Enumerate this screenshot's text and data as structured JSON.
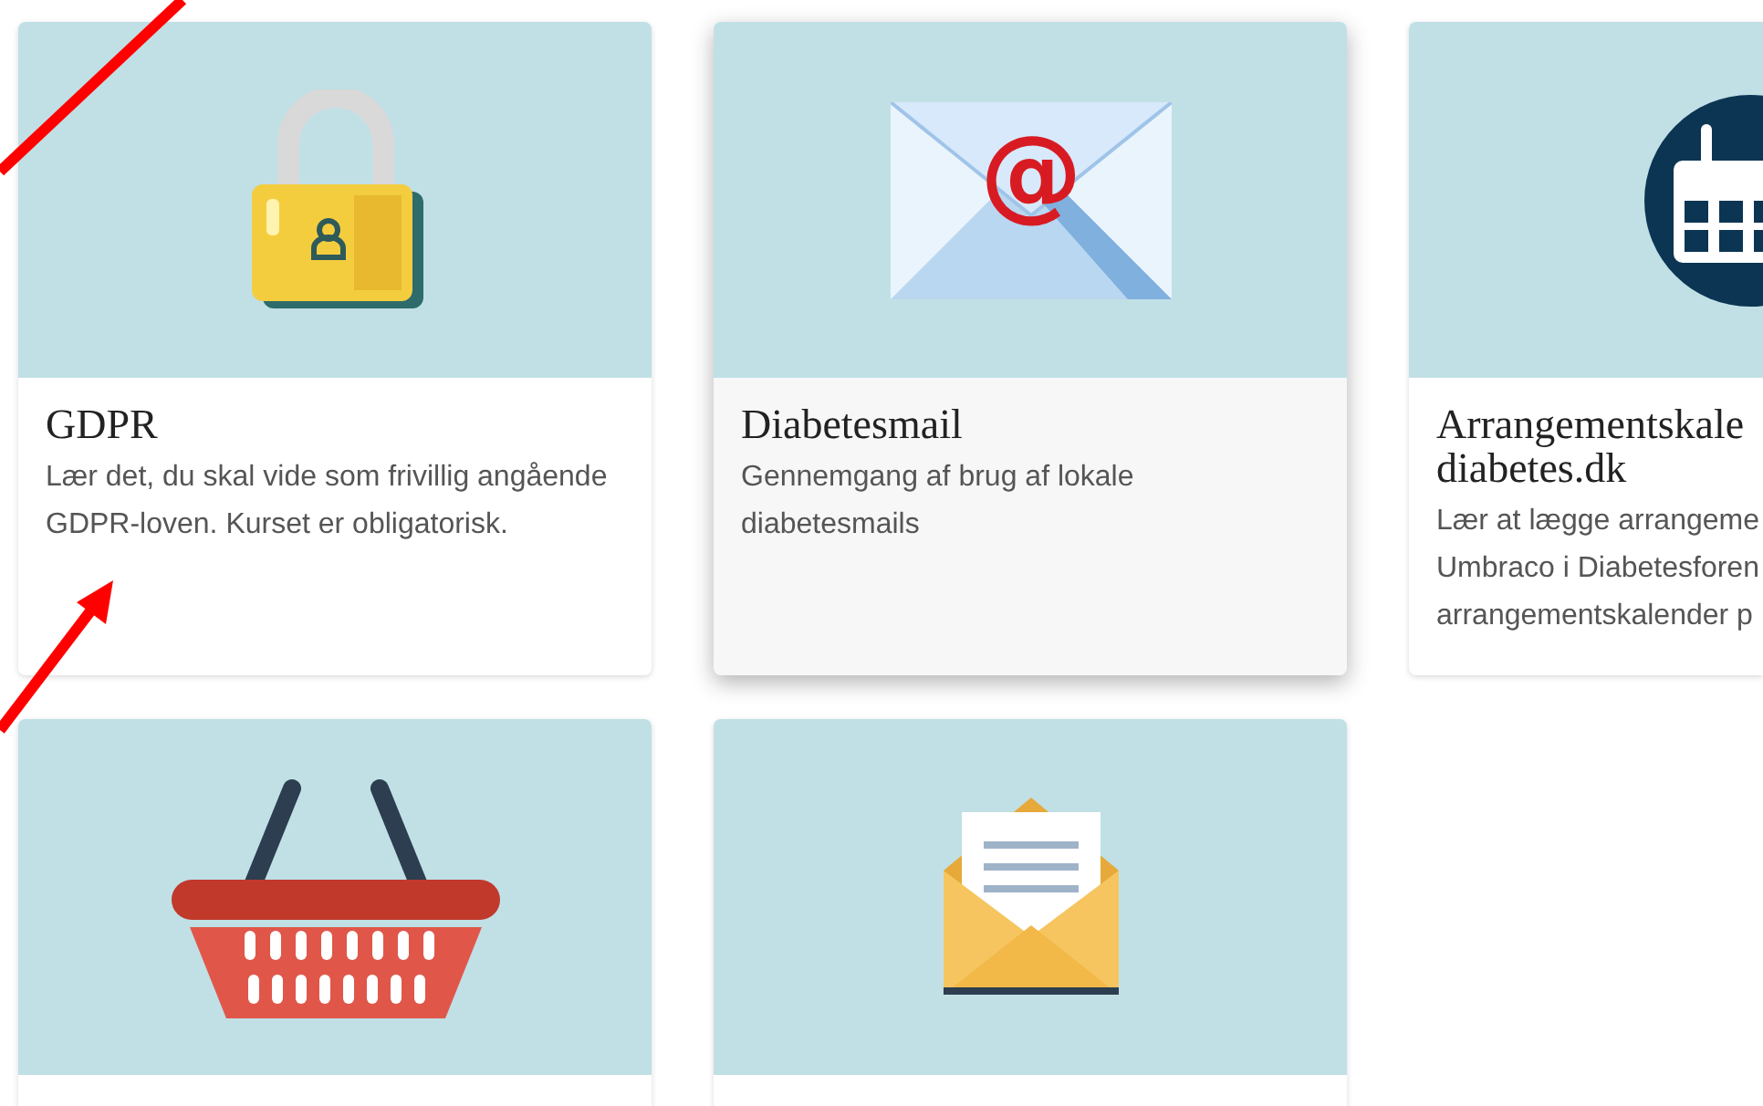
{
  "cards": [
    {
      "title": "GDPR",
      "description": "Lær det, du skal vide som frivillig angående GDPR-loven. Kurset er obligatorisk.",
      "hovered": false
    },
    {
      "icon_text": "@",
      "title": "Diabetesmail",
      "description": "Gennemgang af brug af lokale diabetesmails",
      "hovered": true
    },
    {
      "title": "Arrangementskale\ndiabetes.dk",
      "description": "Lær at lægge arrangeme\nUmbraco i Diabetesforen\narrangementskalender p",
      "hovered": false
    },
    {
      "hovered": false
    },
    {
      "hovered": false
    }
  ],
  "annotations": [
    {
      "kind": "line"
    },
    {
      "kind": "arrow"
    }
  ]
}
